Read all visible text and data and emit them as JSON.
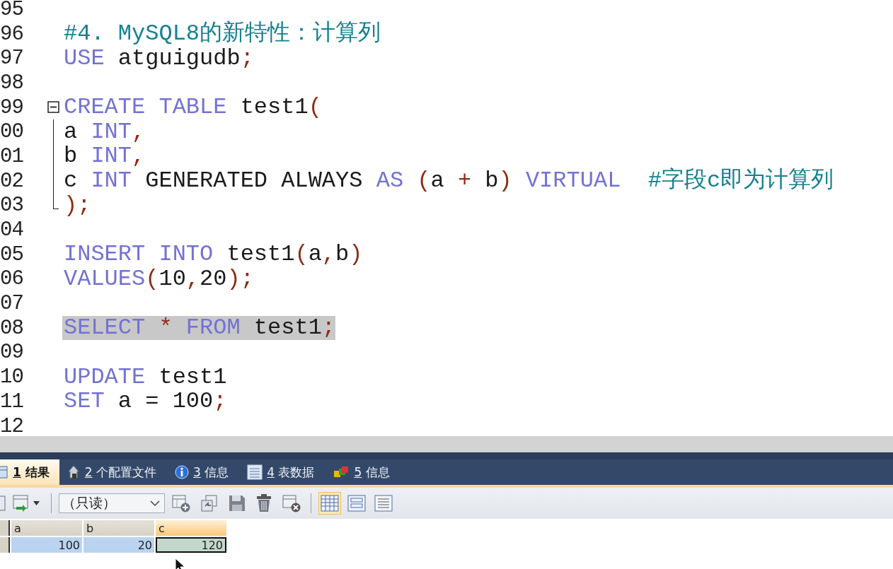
{
  "editor": {
    "lines": [
      {
        "number": "95"
      },
      {
        "number": "96",
        "tokens": [
          {
            "kind": "comment",
            "text": "#4. MySQL8的新特性：计算列"
          }
        ]
      },
      {
        "number": "97",
        "tokens": [
          {
            "kind": "keyword",
            "text": "USE"
          },
          {
            "kind": "plain",
            "text": " atguigudb"
          },
          {
            "kind": "punct",
            "text": ";"
          }
        ]
      },
      {
        "number": "98"
      },
      {
        "number": "99",
        "expanded": true,
        "tokens": [
          {
            "kind": "keyword",
            "text": "CREATE TABLE"
          },
          {
            "kind": "plain",
            "text": " test1"
          },
          {
            "kind": "punct",
            "text": "("
          }
        ],
        "children": [
          {
            "number": "00",
            "tokens": [
              {
                "kind": "plain",
                "text": "a "
              },
              {
                "kind": "keyword",
                "text": "INT"
              },
              {
                "kind": "punct",
                "text": ","
              }
            ]
          },
          {
            "number": "01",
            "tokens": [
              {
                "kind": "plain",
                "text": "b "
              },
              {
                "kind": "keyword",
                "text": "INT"
              },
              {
                "kind": "punct",
                "text": ","
              }
            ]
          },
          {
            "number": "02",
            "tokens": [
              {
                "kind": "plain",
                "text": "c "
              },
              {
                "kind": "keyword",
                "text": "INT"
              },
              {
                "kind": "plain",
                "text": " GENERATED ALWAYS "
              },
              {
                "kind": "keyword",
                "text": "AS"
              },
              {
                "kind": "punct",
                "text": " ("
              },
              {
                "kind": "plain",
                "text": "a "
              },
              {
                "kind": "punct",
                "text": "+"
              },
              {
                "kind": "plain",
                "text": " b"
              },
              {
                "kind": "punct",
                "text": ")"
              },
              {
                "kind": "keyword",
                "text": " VIRTUAL"
              },
              {
                "kind": "comment",
                "text": "  #字段c即为计算列"
              }
            ]
          },
          {
            "number": "03",
            "tokens": [
              {
                "kind": "punct",
                "text": ");"
              }
            ]
          }
        ]
      },
      {
        "number": "04"
      },
      {
        "number": "05",
        "tokens": [
          {
            "kind": "keyword",
            "text": "INSERT INTO"
          },
          {
            "kind": "plain",
            "text": " test1"
          },
          {
            "kind": "punct",
            "text": "("
          },
          {
            "kind": "plain",
            "text": "a"
          },
          {
            "kind": "punct",
            "text": ","
          },
          {
            "kind": "plain",
            "text": "b"
          },
          {
            "kind": "punct",
            "text": ")"
          }
        ]
      },
      {
        "number": "06",
        "tokens": [
          {
            "kind": "keyword",
            "text": "VALUES"
          },
          {
            "kind": "punct",
            "text": "("
          },
          {
            "kind": "plain",
            "text": "10"
          },
          {
            "kind": "punct",
            "text": ","
          },
          {
            "kind": "plain",
            "text": "20"
          },
          {
            "kind": "punct",
            "text": ");"
          }
        ]
      },
      {
        "number": "07"
      },
      {
        "number": "08",
        "highlighted": true,
        "tokens": [
          {
            "kind": "keyword",
            "text": "SELECT"
          },
          {
            "kind": "punct",
            "text": " * "
          },
          {
            "kind": "keyword",
            "text": "FROM"
          },
          {
            "kind": "plain",
            "text": " test1"
          },
          {
            "kind": "punct",
            "text": ";"
          }
        ]
      },
      {
        "number": "09"
      },
      {
        "number": "10",
        "tokens": [
          {
            "kind": "keyword",
            "text": "UPDATE"
          },
          {
            "kind": "plain",
            "text": " test1"
          }
        ]
      },
      {
        "number": "11",
        "tokens": [
          {
            "kind": "keyword",
            "text": "SET"
          },
          {
            "kind": "plain",
            "text": " a = 100"
          },
          {
            "kind": "punct",
            "text": ";"
          }
        ]
      },
      {
        "number": "12"
      }
    ]
  },
  "results": {
    "tabs": [
      {
        "key": "1",
        "label": "结果",
        "selected": true
      },
      {
        "key": "2",
        "label": "个配置文件",
        "selected": false
      },
      {
        "key": "3",
        "label": "信息",
        "selected": false
      },
      {
        "key": "4",
        "label": "表数据",
        "selected": false
      },
      {
        "key": "5",
        "label": "信息",
        "selected": false
      }
    ],
    "toolbar": {
      "mode_select": {
        "value": "（只读）"
      },
      "view_buttons": [
        {
          "selected": true
        },
        {
          "selected": false
        },
        {
          "selected": false
        }
      ]
    },
    "grid": {
      "columns": [
        {
          "name": "a",
          "selected": false
        },
        {
          "name": "b",
          "selected": false
        },
        {
          "name": "c",
          "selected": true
        }
      ],
      "rows": [
        {
          "cells": [
            {
              "value": "100",
              "selected": false
            },
            {
              "value": "20",
              "selected": false
            },
            {
              "value": "120",
              "selected": true
            }
          ]
        }
      ]
    }
  }
}
